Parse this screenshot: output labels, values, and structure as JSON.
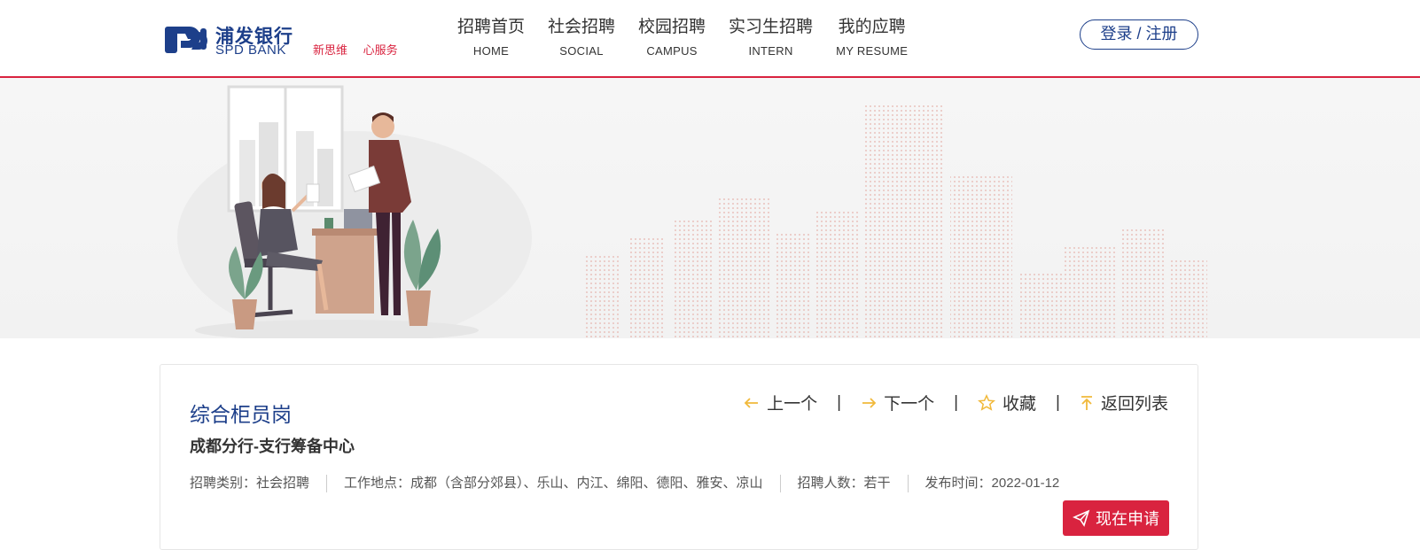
{
  "brand": {
    "name_cn": "浦发银行",
    "name_en": "SPD BANK",
    "slogans": [
      "新思维",
      "心服务"
    ],
    "primary_color": "#1d3f8a",
    "accent_color": "#d9233f"
  },
  "nav": {
    "items": [
      {
        "cn": "招聘首页",
        "en": "HOME"
      },
      {
        "cn": "社会招聘",
        "en": "SOCIAL"
      },
      {
        "cn": "校园招聘",
        "en": "CAMPUS"
      },
      {
        "cn": "实习生招聘",
        "en": "INTERN"
      },
      {
        "cn": "我的应聘",
        "en": "MY RESUME"
      }
    ],
    "login_label": "登录 / 注册"
  },
  "job": {
    "title": "综合柜员岗",
    "department": "成都分行-支行筹备中心",
    "meta": {
      "category": "招聘类别：社会招聘",
      "location": "工作地点：成都（含部分郊县）、乐山、内江、绵阳、德阳、雅安、凉山",
      "headcount": "招聘人数：若干",
      "published": "发布时间：2022-01-12"
    },
    "actions": {
      "prev": "上一个",
      "next": "下一个",
      "favorite": "收藏",
      "back": "返回列表",
      "separator": "|"
    },
    "apply_label": "现在申请"
  }
}
